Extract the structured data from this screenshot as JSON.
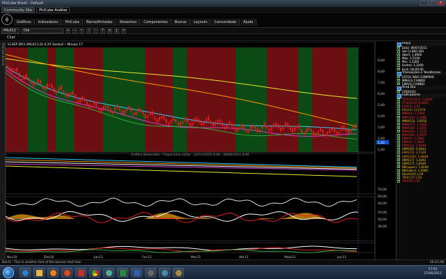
{
  "window": {
    "title": "PhiCube Brasil - Default",
    "controls": [
      "–",
      "□",
      "×"
    ]
  },
  "tabs": [
    {
      "label": "Community Site"
    },
    {
      "label": "PhiCube Análise"
    }
  ],
  "logo": {
    "glyph": "ϕ"
  },
  "menu": [
    "Gráficos",
    "Indicadores",
    "PhiCube",
    "BarrasPintadas",
    "Desenhos",
    "Componentes",
    "Buscar",
    "Layouts",
    "Comunidade",
    "Ajuda"
  ],
  "toolbar": {
    "symbol": "MILK11",
    "period": "Dia"
  },
  "chat": {
    "label": "Chat"
  },
  "leftstrip": {
    "label": "PhiCube Analise"
  },
  "chart": {
    "legend": "ELAEP  DR3 (MILK11.D) 0,25 Santo4 • Mínuto 17",
    "watermark": "Gráfico Deslocado - Clique para voltar - 22/11/2010 0:00 - 28/06/2011 0:00",
    "price_ticks": [
      "9,00",
      "8,00",
      "7,00",
      "6,00",
      "5,00",
      "4,00",
      "3,00",
      "2,00",
      "1,00"
    ],
    "last_price": "1,22",
    "rsi_ticks": [
      "70,00",
      "50,00",
      "30,00"
    ],
    "stoch_ticks": [
      "70,00",
      "50,00",
      "30,00"
    ],
    "x_labels": [
      "Nov10",
      "Dez10",
      "Jan11",
      "Fev11",
      "Mar11",
      "Abr11",
      "Maio11",
      "Jun11"
    ],
    "colors": {
      "up_band": "#6b0f12",
      "down_band": "#0b4a14",
      "candle": "#e02020",
      "ma1": "#ff9900",
      "ma2": "#e8e830",
      "ma3": "#33ccff",
      "ma4": "#cc44cc"
    }
  },
  "panel": {
    "sections": [
      {
        "title": "Preço",
        "rows": [
          {
            "text": "Data: 06/07/2011",
            "color": "#ffffff"
          },
          {
            "text": "Vol:13.800.300",
            "color": "#ffffff"
          },
          {
            "text": "Abert: 1,4900",
            "color": "#ffffff"
          },
          {
            "text": "Máx: 1,5100",
            "color": "#ffffff"
          },
          {
            "text": "Mín: 1,2200",
            "color": "#ffffff"
          },
          {
            "text": "Fechto: 1,2200",
            "color": "#ffffff"
          },
          {
            "text": "Fech: 00:00:00",
            "color": "#ffffff"
          }
        ]
      },
      {
        "title": "Transações e Tendências",
        "rows": [
          {
            "text": "ESTOC NÃO COMPRAR",
            "color": "#ffffff"
          },
          {
            "text": "MMA(4) CAINDO",
            "color": "#ffffff"
          },
          {
            "text": "EMA(5) CAINDO",
            "color": "#ffffff"
          }
        ]
      },
      {
        "title": "Área Dia",
        "rows": [
          {
            "text": "CRD(010)",
            "color": "#ffffff"
          }
        ]
      },
      {
        "title": "Indicadores",
        "rows": [
          {
            "text": "STOCH(14,3): 0,0000",
            "color": "#ff3333"
          },
          {
            "text": "STOCK(14) 0,6400",
            "color": "#ff3333"
          },
          {
            "text": "SAR(4): 4,54",
            "color": "#ff3333"
          },
          {
            "text": "RSI(14) 11,6379",
            "color": "#ff9900"
          },
          {
            "text": "MMA(4): 1,3400",
            "color": "#ff3333"
          },
          {
            "text": "MMA(10): 2,1088",
            "color": "#ff3333"
          },
          {
            "text": "MMA(12): 1,9550",
            "color": "#ffcc00"
          },
          {
            "text": "MMA(21): 1,3624",
            "color": "#ff3333"
          },
          {
            "text": "MMA(40): 1,5875",
            "color": "#ff3333"
          },
          {
            "text": "MMA(60): 1,7531",
            "color": "#ff3333"
          },
          {
            "text": "MMA(84): 0,7837",
            "color": "#ff3333"
          },
          {
            "text": "EMA(5): 1,2900",
            "color": "#ff3333"
          },
          {
            "text": "EMA(9): 1,3964",
            "color": "#ff3333"
          },
          {
            "text": "EMA(21): 1,6049",
            "color": "#ff3333"
          },
          {
            "text": "EMA(50): 0,0642",
            "color": "#ffcc00"
          },
          {
            "text": "EMA(72): 2,7249",
            "color": "#ff9900"
          },
          {
            "text": "EMA(100): 1,9848",
            "color": "#ff9900"
          },
          {
            "text": "SMA(17): 1,4442",
            "color": "#ffcc00"
          },
          {
            "text": "EMA(17): 1,6049",
            "color": "#ffcc00"
          },
          {
            "text": "BB(upper): 1,8244",
            "color": "#ffcc00"
          },
          {
            "text": "BB(lower): 1,0000",
            "color": "#ffcc00"
          },
          {
            "text": "Stoch(14) 1,00",
            "color": "#ffcc00"
          },
          {
            "text": "TRIX(15) 1,00",
            "color": "#ff9900"
          },
          {
            "text": "TRIX(9) 1,00",
            "color": "#ff3333"
          }
        ]
      }
    ]
  },
  "status": {
    "text": "Bot.O - This is another test of the banner text tool.",
    "time": "06:21:48"
  },
  "tray": {
    "time": "17:01",
    "date": "27/06/2011"
  }
}
